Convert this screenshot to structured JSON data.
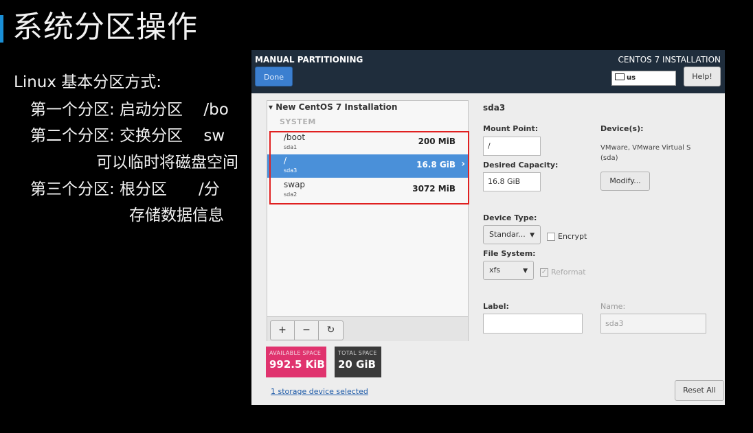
{
  "slide": {
    "title": "系统分区操作",
    "bullets": [
      "Linux 基本分区方式:",
      "第一个分区: 启动分区　 /bo",
      "第二个分区: 交换分区　 sw",
      "可以临时将磁盘空间",
      "第三个分区: 根分区　　/分",
      "存储数据信息"
    ]
  },
  "header": {
    "title": "MANUAL PARTITIONING",
    "done_label": "Done",
    "product_title": "CENTOS 7 INSTALLATION",
    "keyboard_layout": "us",
    "help_label": "Help!"
  },
  "partitions_panel": {
    "installation_title": "New CentOS 7 Installation",
    "section_label": "SYSTEM",
    "partitions": [
      {
        "mount": "/boot",
        "device": "sda1",
        "size": "200 MiB",
        "selected": false
      },
      {
        "mount": "/",
        "device": "sda3",
        "size": "16.8 GiB",
        "selected": true
      },
      {
        "mount": "swap",
        "device": "sda2",
        "size": "3072 MiB",
        "selected": false
      }
    ],
    "add_icon": "+",
    "remove_icon": "−",
    "refresh_icon": "↻"
  },
  "space": {
    "available_label": "AVAILABLE SPACE",
    "available_value": "992.5 KiB",
    "total_label": "TOTAL SPACE",
    "total_value": "20 GiB"
  },
  "storage_link": "1 storage device selected",
  "details": {
    "title": "sda3",
    "mount_point_label": "Mount Point:",
    "mount_point_value": "/",
    "desired_capacity_label": "Desired Capacity:",
    "desired_capacity_value": "16.8 GiB",
    "devices_label": "Device(s):",
    "devices_value": "VMware, VMware Virtual S (sda)",
    "modify_label": "Modify...",
    "device_type_label": "Device Type:",
    "device_type_value": "Standar...",
    "encrypt_label": "Encrypt",
    "file_system_label": "File System:",
    "file_system_value": "xfs",
    "reformat_label": "Reformat",
    "label_label": "Label:",
    "label_value": "",
    "name_label": "Name:",
    "name_value": "sda3"
  },
  "reset_label": "Reset All",
  "colors": {
    "header_bg": "#1f2d3c",
    "done_button": "#3b7fd0",
    "selected_row": "#4a90d9",
    "available_space": "#e0336e",
    "total_space": "#3a3a3a",
    "highlight_box": "#e02020",
    "slide_accent": "#1a8fd6"
  }
}
